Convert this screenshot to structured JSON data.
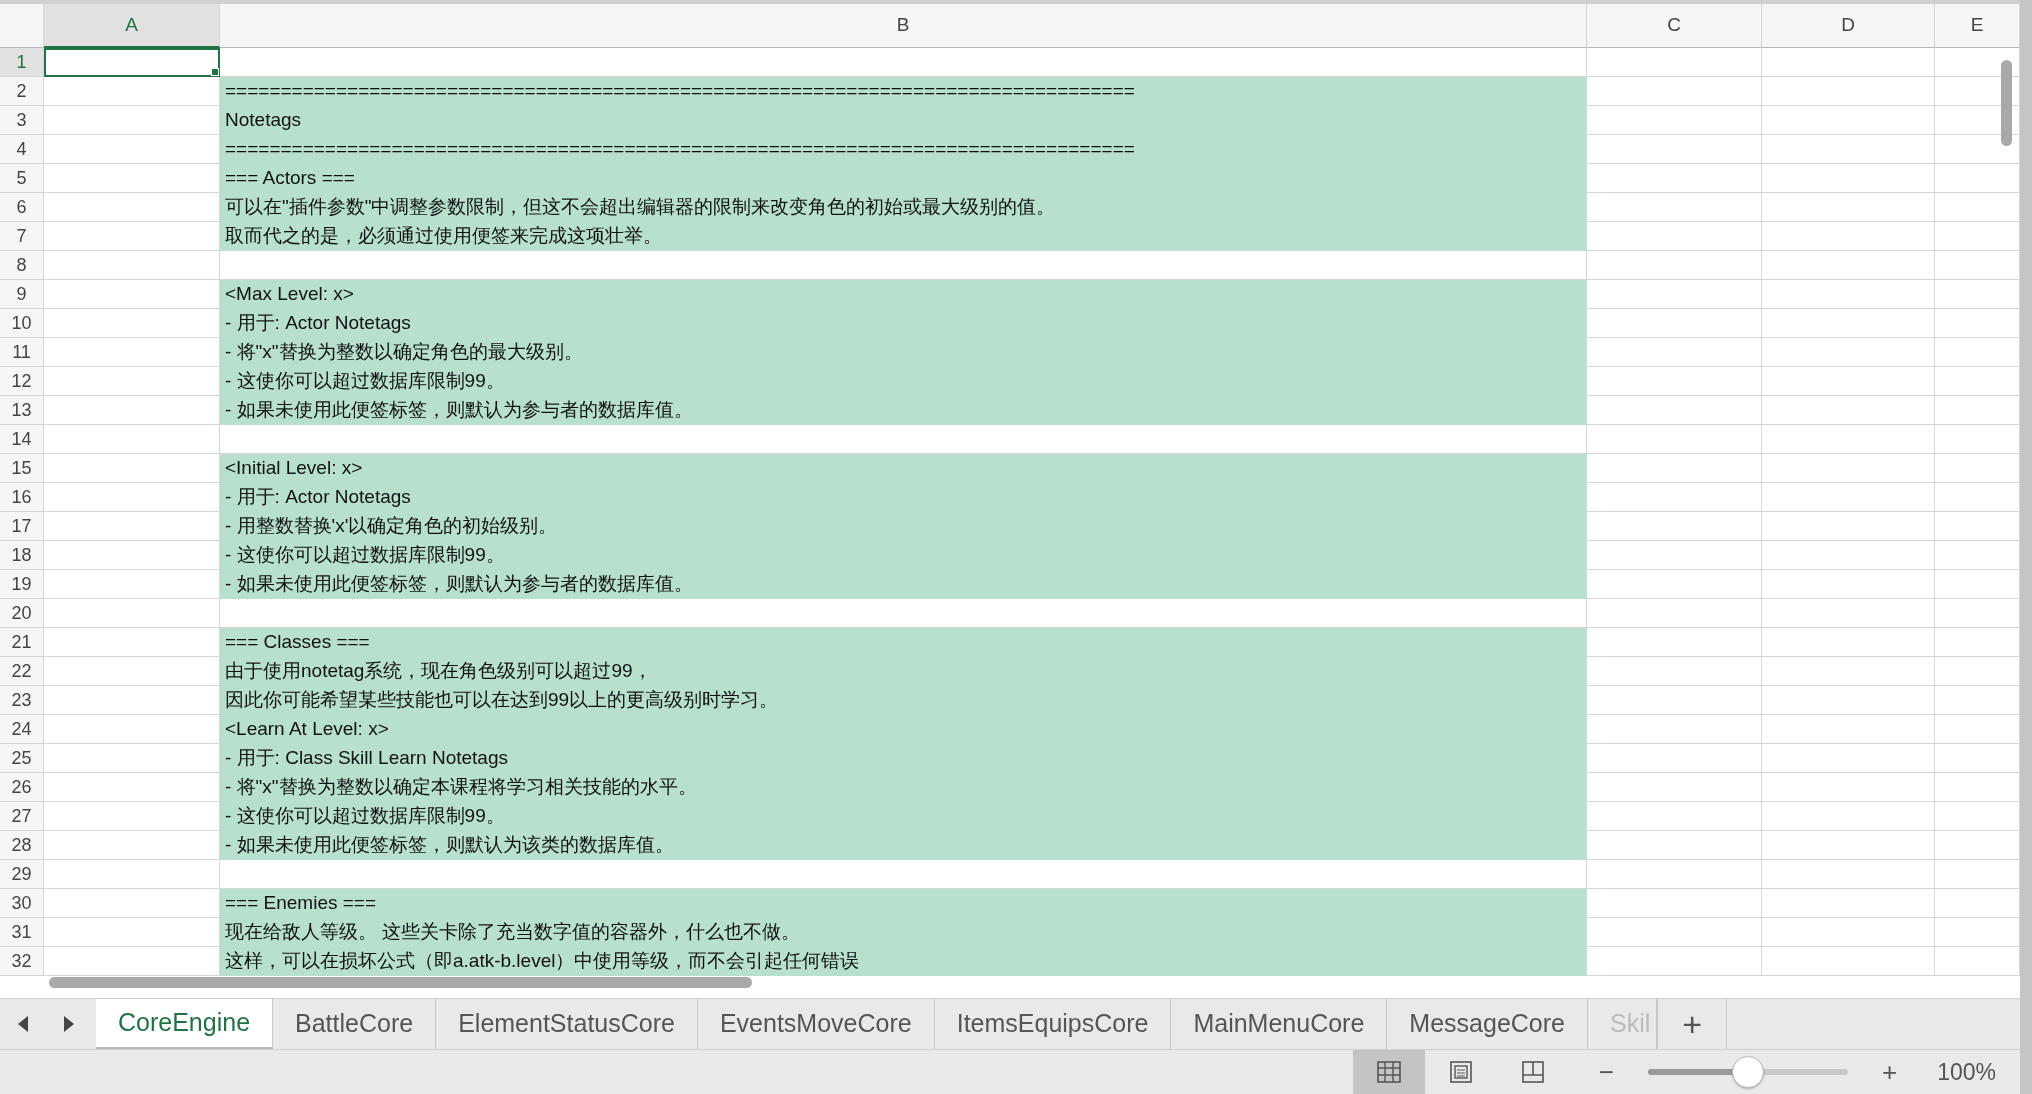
{
  "columns": [
    {
      "label": "A",
      "selected": true
    },
    {
      "label": "B",
      "selected": false
    },
    {
      "label": "C",
      "selected": false
    },
    {
      "label": "D",
      "selected": false
    },
    {
      "label": "E",
      "selected": false
    }
  ],
  "rows": [
    {
      "number": "1",
      "selected": true,
      "highlighted": false
    },
    {
      "number": "2",
      "selected": false,
      "highlighted": true,
      "text": "=================================================================================="
    },
    {
      "number": "3",
      "selected": false,
      "highlighted": true,
      "text": "Notetags"
    },
    {
      "number": "4",
      "selected": false,
      "highlighted": true,
      "text": "=================================================================================="
    },
    {
      "number": "5",
      "selected": false,
      "highlighted": true,
      "text": "=== Actors ==="
    },
    {
      "number": "6",
      "selected": false,
      "highlighted": true,
      "text": "可以在\"插件参数\"中调整参数限制，但这不会超出编辑器的限制来改变角色的初始或最大级别的值。"
    },
    {
      "number": "7",
      "selected": false,
      "highlighted": true,
      "text": "取而代之的是，必须通过使用便签来完成这项壮举。"
    },
    {
      "number": "8",
      "selected": false,
      "highlighted": false
    },
    {
      "number": "9",
      "selected": false,
      "highlighted": true,
      "text": "<Max Level: x>"
    },
    {
      "number": "10",
      "selected": false,
      "highlighted": true,
      "text": "- 用于: Actor Notetags"
    },
    {
      "number": "11",
      "selected": false,
      "highlighted": true,
      "text": "- 将\"x\"替换为整数以确定角色的最大级别。"
    },
    {
      "number": "12",
      "selected": false,
      "highlighted": true,
      "text": "- 这使你可以超过数据库限制99。"
    },
    {
      "number": "13",
      "selected": false,
      "highlighted": true,
      "text": "- 如果未使用此便签标签，则默认为参与者的数据库值。"
    },
    {
      "number": "14",
      "selected": false,
      "highlighted": false
    },
    {
      "number": "15",
      "selected": false,
      "highlighted": true,
      "text": "<Initial Level: x>"
    },
    {
      "number": "16",
      "selected": false,
      "highlighted": true,
      "text": "- 用于: Actor Notetags"
    },
    {
      "number": "17",
      "selected": false,
      "highlighted": true,
      "text": "- 用整数替换'x'以确定角色的初始级别。"
    },
    {
      "number": "18",
      "selected": false,
      "highlighted": true,
      "text": "- 这使你可以超过数据库限制99。"
    },
    {
      "number": "19",
      "selected": false,
      "highlighted": true,
      "text": "- 如果未使用此便签标签，则默认为参与者的数据库值。"
    },
    {
      "number": "20",
      "selected": false,
      "highlighted": false
    },
    {
      "number": "21",
      "selected": false,
      "highlighted": true,
      "text": "=== Classes ==="
    },
    {
      "number": "22",
      "selected": false,
      "highlighted": true,
      "text": "由于使用notetag系统，现在角色级别可以超过99，"
    },
    {
      "number": "23",
      "selected": false,
      "highlighted": true,
      "text": "因此你可能希望某些技能也可以在达到99以上的更高级别时学习。"
    },
    {
      "number": "24",
      "selected": false,
      "highlighted": true,
      "text": "<Learn At Level: x>"
    },
    {
      "number": "25",
      "selected": false,
      "highlighted": true,
      "text": "- 用于: Class Skill Learn Notetags"
    },
    {
      "number": "26",
      "selected": false,
      "highlighted": true,
      "text": "- 将\"x\"替换为整数以确定本课程将学习相关技能的水平。"
    },
    {
      "number": "27",
      "selected": false,
      "highlighted": true,
      "text": "- 这使你可以超过数据库限制99。"
    },
    {
      "number": "28",
      "selected": false,
      "highlighted": true,
      "text": "- 如果未使用此便签标签，则默认为该类的数据库值。"
    },
    {
      "number": "29",
      "selected": false,
      "highlighted": false
    },
    {
      "number": "30",
      "selected": false,
      "highlighted": true,
      "text": "=== Enemies ==="
    },
    {
      "number": "31",
      "selected": false,
      "highlighted": true,
      "text": "现在给敌人等级。 这些关卡除了充当数字值的容器外，什么也不做。"
    },
    {
      "number": "32",
      "selected": false,
      "highlighted": true,
      "text": "这样，可以在损坏公式（即a.atk-b.level）中使用等级，而不会引起任何错误"
    }
  ],
  "sheet_tabs": [
    {
      "label": "CoreEngine",
      "selected": true
    },
    {
      "label": "BattleCore",
      "selected": false
    },
    {
      "label": "ElementStatusCore",
      "selected": false
    },
    {
      "label": "EventsMoveCore",
      "selected": false
    },
    {
      "label": "ItemsEquipsCore",
      "selected": false
    },
    {
      "label": "MainMenuCore",
      "selected": false
    },
    {
      "label": "MessageCore",
      "selected": false
    },
    {
      "label": "Skil",
      "selected": false
    }
  ],
  "add_sheet": "+",
  "status_bar": {
    "views": [
      {
        "kind": "normal",
        "selected": true
      },
      {
        "kind": "page_layout",
        "selected": false
      },
      {
        "kind": "page_break",
        "selected": false
      }
    ],
    "zoom_out": "−",
    "zoom_in": "+",
    "zoom": {
      "level": 0.5,
      "reading": "100%"
    }
  }
}
